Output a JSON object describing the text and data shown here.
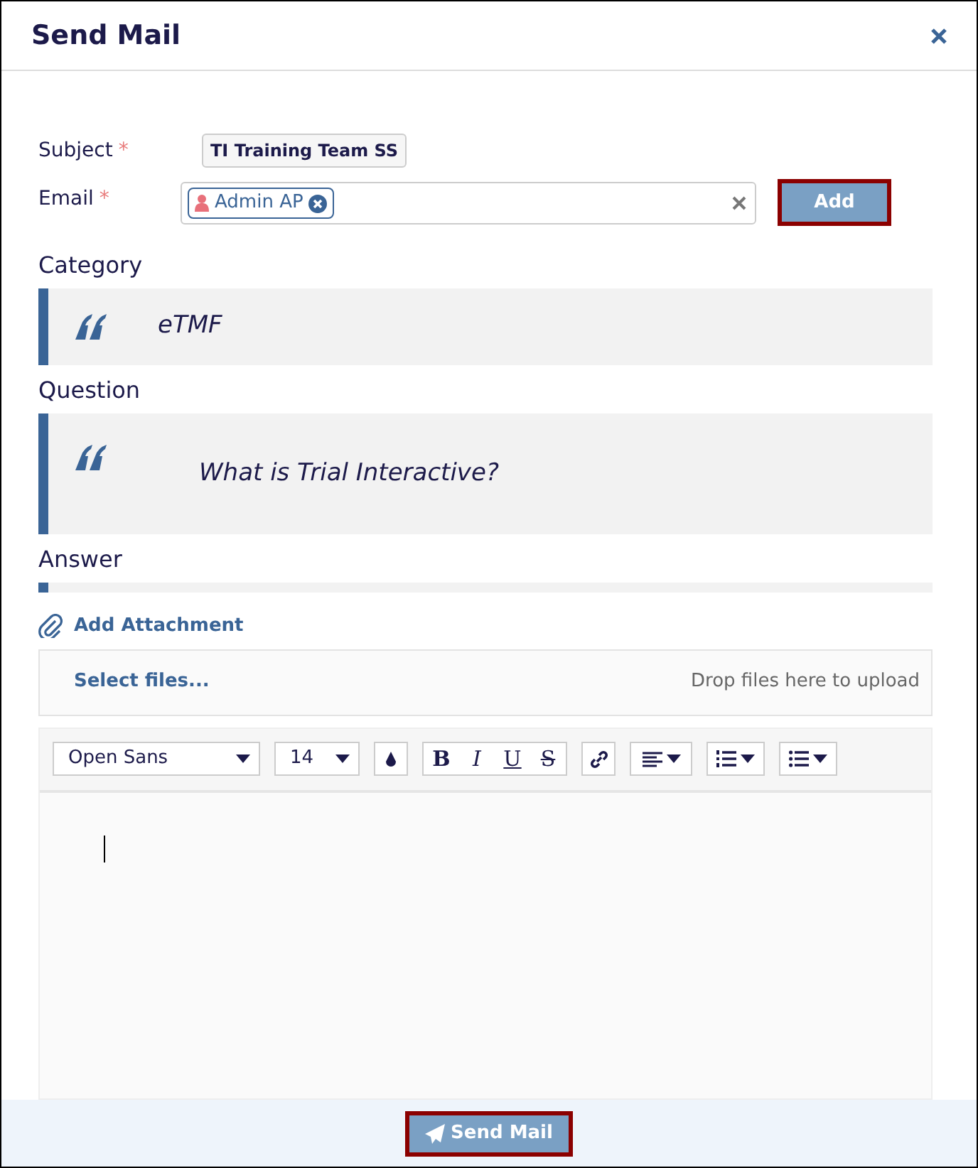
{
  "dialog": {
    "title": "Send Mail"
  },
  "fields": [
    {
      "label": "Subject",
      "required_mark": "*",
      "value": "TI Training Team SS"
    },
    {
      "label": "Email",
      "required_mark": "*",
      "tokens": [
        "Admin AP"
      ],
      "button": "Add"
    }
  ],
  "sections": [
    {
      "heading": "Category",
      "text": "eTMF"
    },
    {
      "heading": "Question",
      "text": "What is Trial Interactive?"
    },
    {
      "heading": "Answer"
    }
  ],
  "attachment": {
    "link": "Add Attachment",
    "select": "Select files...",
    "drop_hint": "Drop files here to upload"
  },
  "editor": {
    "font": "Open Sans",
    "font_size": "14",
    "format_buttons": [
      {
        "label": "B",
        "kind": "bold"
      },
      {
        "label": "I",
        "kind": "italic"
      },
      {
        "label": "U",
        "kind": "underline"
      },
      {
        "label": "S",
        "kind": "strike"
      }
    ]
  },
  "footer": {
    "button": "Send Mail"
  }
}
